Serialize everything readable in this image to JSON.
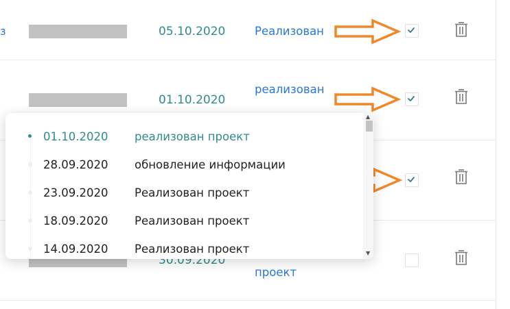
{
  "rows": [
    {
      "date": "05.10.2020",
      "status": "Реализован",
      "checked": true
    },
    {
      "date": "01.10.2020",
      "status": "реализован",
      "checked": true
    },
    {
      "date": "",
      "status": "",
      "checked": true
    },
    {
      "date": "30.09.2020",
      "status": "проект",
      "checked": false
    }
  ],
  "history_popup": {
    "entries": [
      {
        "date": "01.10.2020",
        "text": "реализован проект",
        "active": true
      },
      {
        "date": "28.09.2020",
        "text": "обновление информации",
        "active": false
      },
      {
        "date": "23.09.2020",
        "text": "Реализован проект",
        "active": false
      },
      {
        "date": "18.09.2020",
        "text": "Реализован проект",
        "active": false
      },
      {
        "date": "14.09.2020",
        "text": "Реализован проект",
        "active": false
      }
    ]
  },
  "icons": {
    "checkbox_tick": "check-icon",
    "delete": "trash-icon",
    "annotation_arrow": "arrow-right-icon",
    "scroll_up": "triangle-up-icon",
    "scroll_down": "triangle-down-icon"
  },
  "colors": {
    "date_teal": "#2f8b8e",
    "status_blue": "#2a78d6",
    "arrow_orange": "#f0882a",
    "redacted_gray": "#c2c2c2"
  }
}
